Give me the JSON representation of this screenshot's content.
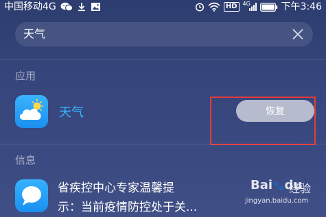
{
  "status_bar": {
    "carrier": "中国移动4G",
    "hd_badge": "HD",
    "network_badge": "4G",
    "time": "下午3:46",
    "icons": [
      "wechat-icon",
      "download-icon",
      "image-icon",
      "alarm-icon",
      "wifi-icon",
      "signal-icon",
      "battery-icon"
    ]
  },
  "search": {
    "query": "天气",
    "clear_icon": "close-icon"
  },
  "sections": {
    "apps_label": "应用",
    "info_label": "信息"
  },
  "app_result": {
    "name": "天气",
    "icon": "weather-icon",
    "action_label": "恢复"
  },
  "info_result": {
    "icon": "message-icon",
    "line1": "省疾控中心专家温馨提",
    "line2": "示：当前疫情防控处于关..."
  },
  "watermark": {
    "brand": "Bai",
    "brand2": "du",
    "product": "经验",
    "url": "jingyan.baidu.com"
  },
  "colors": {
    "accent": "#38b6ff",
    "highlight": "#e43b3b"
  }
}
